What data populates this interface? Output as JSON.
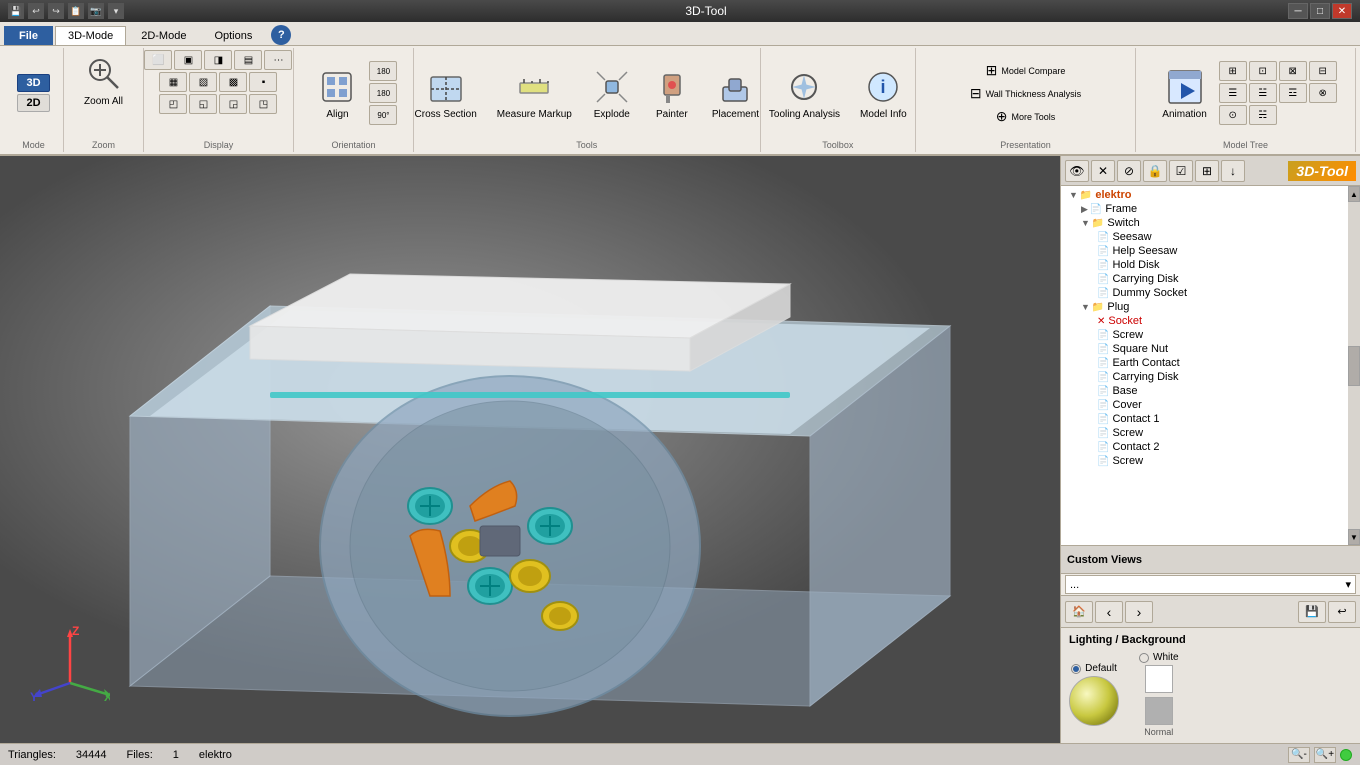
{
  "titlebar": {
    "title": "3D-Tool",
    "minimize_label": "─",
    "maximize_label": "□",
    "close_label": "✕",
    "quick_access": [
      "💾",
      "↩",
      "↪",
      "📋",
      "📷",
      "🔊"
    ]
  },
  "ribbon": {
    "tabs": [
      {
        "id": "file",
        "label": "File",
        "active": false,
        "is_file": true
      },
      {
        "id": "3dmode",
        "label": "3D-Mode",
        "active": true,
        "is_file": false
      },
      {
        "id": "2dmode",
        "label": "2D-Mode",
        "active": false,
        "is_file": false
      },
      {
        "id": "options",
        "label": "Options",
        "active": false,
        "is_file": false
      }
    ],
    "groups": {
      "mode": {
        "label": "Mode",
        "buttons": [
          "3D",
          "2D"
        ]
      },
      "zoom": {
        "label": "Zoom",
        "zoom_all": "Zoom All"
      },
      "display": {
        "label": "Display"
      },
      "orientation": {
        "label": "Orientation",
        "align_label": "Align"
      },
      "tools": {
        "label": "Tools",
        "cross_section": "Cross Section",
        "measure_markup": "Measure Markup",
        "explode": "Explode",
        "painter": "Painter",
        "placement": "Placement"
      },
      "toolbox": {
        "label": "Toolbox",
        "tooling_analysis": "Tooling Analysis",
        "model_info": "Model Info"
      },
      "presentation": {
        "label": "Presentation",
        "model_compare": "Model Compare",
        "wall_thickness": "Wall Thickness Analysis",
        "more_tools": "More Tools",
        "animation": "Animation"
      },
      "model_tree": {
        "label": "Model Tree"
      }
    }
  },
  "tree": {
    "title": "elektro",
    "items": [
      {
        "id": "elektro",
        "label": "elektro",
        "level": 0,
        "type": "root",
        "expanded": true
      },
      {
        "id": "frame",
        "label": "Frame",
        "level": 1,
        "type": "node",
        "expanded": false
      },
      {
        "id": "switch",
        "label": "Switch",
        "level": 1,
        "type": "node",
        "expanded": true
      },
      {
        "id": "seesaw",
        "label": "Seesaw",
        "level": 2,
        "type": "leaf"
      },
      {
        "id": "help_seesaw",
        "label": "Help Seesaw",
        "level": 2,
        "type": "leaf"
      },
      {
        "id": "hold_disk",
        "label": "Hold Disk",
        "level": 2,
        "type": "leaf"
      },
      {
        "id": "carrying_disk_sw",
        "label": "Carrying Disk",
        "level": 2,
        "type": "leaf"
      },
      {
        "id": "dummy_socket",
        "label": "Dummy Socket",
        "level": 2,
        "type": "leaf"
      },
      {
        "id": "plug",
        "label": "Plug",
        "level": 1,
        "type": "node",
        "expanded": true
      },
      {
        "id": "socket",
        "label": "Socket",
        "level": 2,
        "type": "leaf",
        "red": true
      },
      {
        "id": "screw1",
        "label": "Screw",
        "level": 2,
        "type": "leaf"
      },
      {
        "id": "square_nut",
        "label": "Square Nut",
        "level": 2,
        "type": "leaf"
      },
      {
        "id": "earth_contact",
        "label": "Earth Contact",
        "level": 2,
        "type": "leaf"
      },
      {
        "id": "carrying_disk",
        "label": "Carrying Disk",
        "level": 2,
        "type": "leaf"
      },
      {
        "id": "base",
        "label": "Base",
        "level": 2,
        "type": "leaf"
      },
      {
        "id": "cover",
        "label": "Cover",
        "level": 2,
        "type": "leaf"
      },
      {
        "id": "contact1",
        "label": "Contact 1",
        "level": 2,
        "type": "leaf"
      },
      {
        "id": "screw2",
        "label": "Screw",
        "level": 2,
        "type": "leaf"
      },
      {
        "id": "contact2",
        "label": "Contact 2",
        "level": 2,
        "type": "leaf"
      },
      {
        "id": "screw3",
        "label": "Screw",
        "level": 2,
        "type": "leaf"
      }
    ]
  },
  "custom_views": {
    "label": "Custom Views",
    "dropdown_placeholder": "..."
  },
  "views_toolbar": {
    "prev_label": "‹",
    "next_label": "›",
    "home_icon": "🏠",
    "save_icon": "💾",
    "undo_icon": "↩"
  },
  "lighting": {
    "title": "Lighting / Background",
    "default_label": "Default",
    "white_label": "White",
    "normal_label": "Normal"
  },
  "statusbar": {
    "triangles_label": "Triangles:",
    "triangles_value": "34444",
    "files_label": "Files:",
    "files_value": "1",
    "model_name": "elektro"
  }
}
